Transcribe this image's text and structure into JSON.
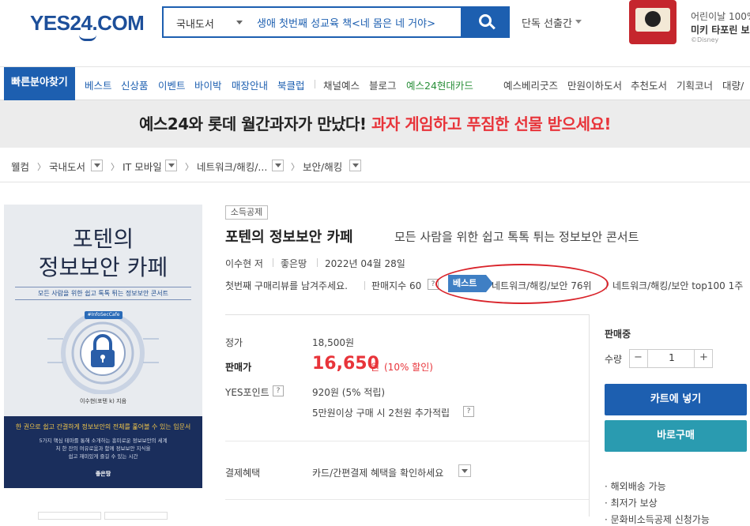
{
  "header": {
    "logo_text": "YES24.COM",
    "search_category": "국내도서",
    "search_query": "생애 첫번째 성교육 책<네 몸은 네 거야>",
    "exclusive_menu": "단독 선출간",
    "promo_line1": "어린이날 100%",
    "promo_line2": "미키 타포린 보냉",
    "promo_line3": "©Disney"
  },
  "gnb": {
    "quick_find": "빠른분야찾기",
    "items": [
      "베스트",
      "신상품",
      "이벤트",
      "바이박",
      "매장안내",
      "북클럽",
      "채널예스",
      "블로그",
      "예스24현대카드",
      "예스베리굿즈",
      "만원이하도서",
      "추천도서",
      "기획코너",
      "대량/"
    ]
  },
  "banner": {
    "text_black": "예스24와 롯데 월간과자가 만났다! ",
    "text_red": "과자 게임하고 푸짐한 선물 받으세요!"
  },
  "breadcrumb": [
    "웰컴",
    "국내도서",
    "IT 모바일",
    "네트워크/해킹/...",
    "보안/해킹"
  ],
  "cover": {
    "title_line1": "포텐의",
    "title_line2": "정보보안 카페",
    "subtitle": "모든 사람을 위한 쉽고 톡톡 튀는 정보보안 콘서트",
    "tag": "#InfoSecCafe",
    "author": "이수현(포텐 k) 지음",
    "bottom_headline": "한 권으로 쉽고 간결하게 정보보안의 전체를 훑어볼 수 있는 입문서",
    "bottom_desc1": "5가지 핵심 테마를 통해 소개하는 흥미로운 정보보안의 세계",
    "bottom_desc2": "처 한 잔의 여유로움과 함께 정보보안 지식을",
    "bottom_desc3": "쉽고 재미있게 즐길 수 있는 시간",
    "publisher": "좋은땅"
  },
  "product": {
    "tax_badge": "소득공제",
    "title": "포텐의 정보보안 카페",
    "subtitle": "모든 사람을 위한 쉽고 톡톡 튀는 정보보안 콘서트",
    "author": "이수현 저",
    "publisher": "좋은땅",
    "date": "2022년 04월 28일",
    "review_prompt": "첫번째 구매리뷰를 남겨주세요.",
    "sales_index_label": "판매지수 60",
    "best_badge": "베스트",
    "rank1": "네트워크/해킹/보안 76위",
    "rank2": "네트워크/해킹/보안 top100 1주"
  },
  "price": {
    "list_label": "정가",
    "list_price": "18,500원",
    "sale_label": "판매가",
    "sale_price": "16,650",
    "sale_unit": "원",
    "discount": "(10% 할인)",
    "points_label": "YES포인트",
    "points_value": "920원 (5% 적립)",
    "points_extra": "5만원이상 구매 시 2천원 추가적립",
    "payment_label": "결제혜택",
    "payment_value": "카드/간편결제 혜택을 확인하세요"
  },
  "buy": {
    "status": "판매중",
    "qty_label": "수량",
    "qty_value": "1",
    "minus": "−",
    "plus": "+",
    "cart": "카트에 넣기",
    "buy_now": "바로구매",
    "bullet1": "· 해외배송 가능",
    "bullet2": "· 최저가 보상",
    "bullet3": "· 문화비소득공제 신청가능"
  },
  "colors": {
    "brand_blue": "#1d5fb0",
    "sale_red": "#e8343a",
    "buy_teal": "#2a9bb0",
    "annotation_red": "#d9232a"
  }
}
